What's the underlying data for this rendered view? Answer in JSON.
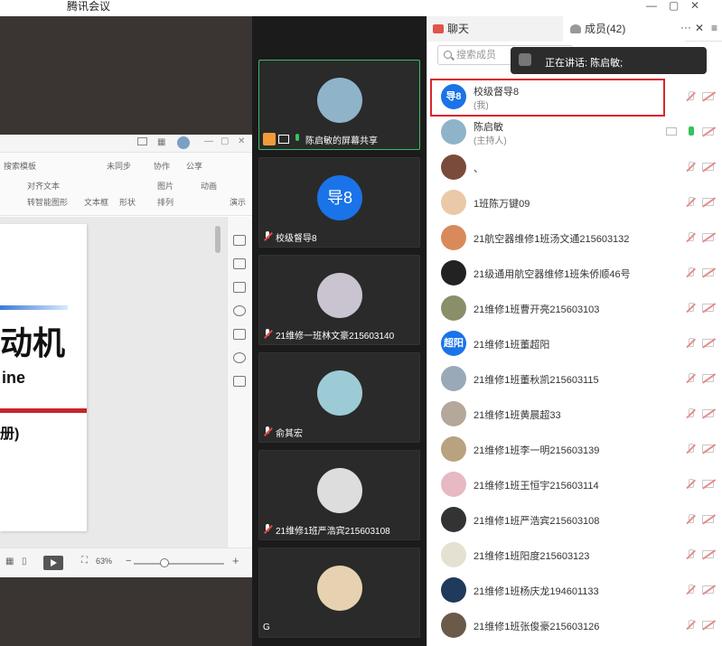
{
  "window": {
    "title": "腾讯会议"
  },
  "share": {
    "doc_search": "搜索模板",
    "ribbon": [
      "未同步",
      "协作",
      "公享",
      "对齐文本",
      "文本框",
      "形状",
      "图片",
      "排列",
      "动画",
      "转智能图形",
      "演示"
    ],
    "slide_title": "动机",
    "slide_subtitle": "ine",
    "slide_volume": "册)",
    "zoom": "63%"
  },
  "videos": [
    {
      "name": "陈启敏的屏幕共享",
      "active": true,
      "avatar_color": "#8fb3c9",
      "avatar_text": ""
    },
    {
      "name": "校级督导8",
      "active": false,
      "avatar_color": "#1a73e8",
      "avatar_text": "导8"
    },
    {
      "name": "21维修一班林文豪215603140",
      "active": false,
      "avatar_color": "#c9c4cf",
      "avatar_text": ""
    },
    {
      "name": "俞其宏",
      "active": false,
      "avatar_color": "#9ccbd6",
      "avatar_text": ""
    },
    {
      "name": "21维修1班严浩宾215603108",
      "active": false,
      "avatar_color": "#ddd",
      "avatar_text": ""
    },
    {
      "name": "G",
      "active": false,
      "avatar_color": "#e6d2b0",
      "avatar_text": ""
    }
  ],
  "panel": {
    "tab_chat": "聊天",
    "tab_members": "成员(42)",
    "search_placeholder": "搜索成员",
    "speaking_label": "正在讲话: 陈启敏;"
  },
  "members": [
    {
      "name": "校级督导8",
      "sub": "(我)",
      "avatar_text": "导8",
      "avatar_color": "#1a73e8",
      "mic": "off",
      "share": false
    },
    {
      "name": "陈启敏",
      "sub": "(主持人)",
      "avatar_text": "",
      "avatar_color": "#8fb3c9",
      "mic": "on",
      "share": true
    },
    {
      "name": "、",
      "sub": "",
      "avatar_text": "",
      "avatar_color": "#7a4b3a",
      "mic": "off",
      "share": false
    },
    {
      "name": "1班陈万键09",
      "sub": "",
      "avatar_text": "",
      "avatar_color": "#e9c9a8",
      "mic": "off",
      "share": false
    },
    {
      "name": "21航空器维修1班汤文通215603132",
      "sub": "",
      "avatar_text": "",
      "avatar_color": "#d98a5a",
      "mic": "off",
      "share": false
    },
    {
      "name": "21级通用航空器维修1班朱侨顺46号",
      "sub": "",
      "avatar_text": "",
      "avatar_color": "#222",
      "mic": "off",
      "share": false
    },
    {
      "name": "21维修1班曹开亮215603103",
      "sub": "",
      "avatar_text": "",
      "avatar_color": "#8a8f6a",
      "mic": "off",
      "share": false
    },
    {
      "name": "21维修1班董超阳",
      "sub": "",
      "avatar_text": "超阳",
      "avatar_color": "#1a73e8",
      "mic": "off",
      "share": false
    },
    {
      "name": "21维修1班董秋凯215603115",
      "sub": "",
      "avatar_text": "",
      "avatar_color": "#9aa9b7",
      "mic": "off",
      "share": false
    },
    {
      "name": "21维修1班黄晨超33",
      "sub": "",
      "avatar_text": "",
      "avatar_color": "#b5a79a",
      "mic": "off",
      "share": false
    },
    {
      "name": "21维修1班李一明215603139",
      "sub": "",
      "avatar_text": "",
      "avatar_color": "#b8a27f",
      "mic": "off",
      "share": false
    },
    {
      "name": "21维修1班王恒宇215603114",
      "sub": "",
      "avatar_text": "",
      "avatar_color": "#e7b9c2",
      "mic": "off",
      "share": false
    },
    {
      "name": "21维修1班严浩宾215603108",
      "sub": "",
      "avatar_text": "",
      "avatar_color": "#333",
      "mic": "off",
      "share": false
    },
    {
      "name": "21维修1班阳度215603123",
      "sub": "",
      "avatar_text": "",
      "avatar_color": "#e6e0d3",
      "mic": "off",
      "share": false
    },
    {
      "name": "21维修1班杨庆龙194601133",
      "sub": "",
      "avatar_text": "",
      "avatar_color": "#1f3a5a",
      "mic": "off",
      "share": false
    },
    {
      "name": "21维修1班张俊豪215603126",
      "sub": "",
      "avatar_text": "",
      "avatar_color": "#6b5a4a",
      "mic": "off",
      "share": false
    }
  ]
}
